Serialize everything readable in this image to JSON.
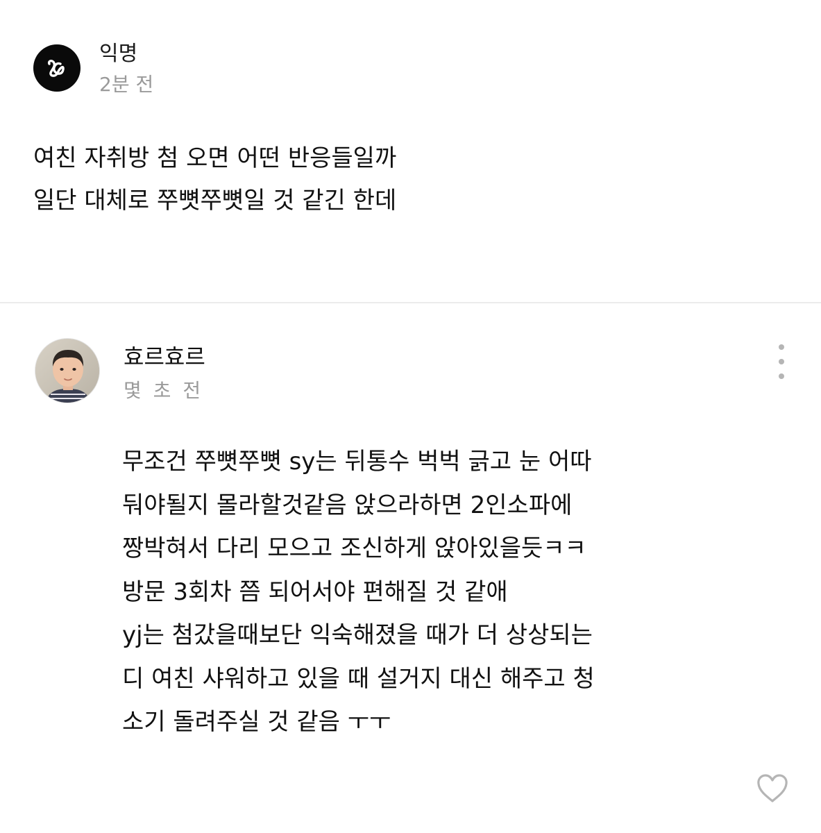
{
  "post": {
    "author": "익명",
    "time": "2분 전",
    "avatar_icon": "anonymous-logo-icon",
    "body_lines": [
      "여친 자취방 첨 오면 어떤 반응들일까",
      "일단 대체로 쭈뼛쭈뼛일 것 같긴 한데"
    ]
  },
  "comment": {
    "author": "효르효르",
    "time": "몇 초 전",
    "avatar": "child-profile-photo",
    "body_lines": [
      "무조건 쭈뼛쭈뼛 sy는 뒤통수 벅벅 긁고 눈 어따",
      "둬야될지 몰라할것같음 앉으라하면 2인소파에",
      "짱박혀서 다리 모으고 조신하게 앉아있을듯ㅋㅋ",
      "방문 3회차 쯤 되어서야 편해질 것 같애",
      "yj는 첨갔을때보단 익숙해졌을 때가 더 상상되는",
      "디 여친 샤워하고 있을 때 설거지 대신 해주고 청",
      "소기 돌려주실 것 같음 ㅜㅜ"
    ],
    "more_icon": "more-vertical-icon",
    "like_icon": "heart-outline-icon"
  },
  "colors": {
    "text": "#111111",
    "muted": "#9a9a9a",
    "divider": "#ececec",
    "icon": "#b5b5b5"
  }
}
